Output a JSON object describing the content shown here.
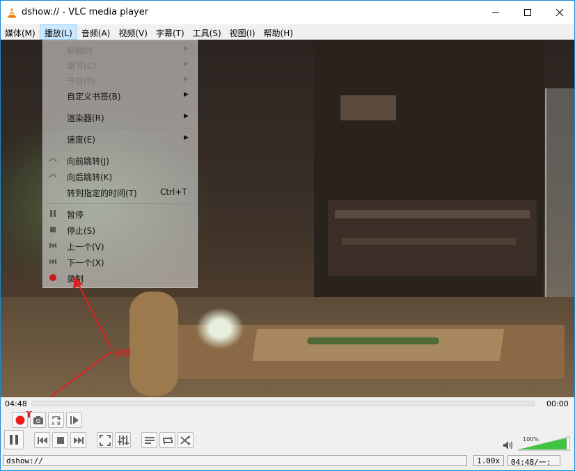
{
  "window": {
    "title": "dshow:// - VLC media player"
  },
  "menubar": [
    {
      "label": "媒体(M)"
    },
    {
      "label": "播放(L)"
    },
    {
      "label": "音频(A)"
    },
    {
      "label": "视频(V)"
    },
    {
      "label": "字幕(T)"
    },
    {
      "label": "工具(S)"
    },
    {
      "label": "视图(I)"
    },
    {
      "label": "帮助(H)"
    }
  ],
  "playback_menu": {
    "items": [
      {
        "label": "标题(I)",
        "disabled": true,
        "submenu": true
      },
      {
        "label": "章节(C)",
        "disabled": true,
        "submenu": true
      },
      {
        "label": "节目(P)",
        "disabled": true,
        "submenu": true
      },
      {
        "label": "自定义书签(B)",
        "submenu": true
      },
      {
        "label": "渲染器(R)",
        "submenu": true
      },
      {
        "label": "速度(E)",
        "submenu": true
      },
      {
        "label": "向前跳转(J)",
        "icon": "jump-forward-icon"
      },
      {
        "label": "向后跳转(K)",
        "icon": "jump-backward-icon"
      },
      {
        "label": "转到指定的时间(T)",
        "shortcut": "Ctrl+T"
      },
      {
        "label": "暂停",
        "icon": "pause-icon"
      },
      {
        "label": "停止(S)",
        "icon": "stop-icon"
      },
      {
        "label": "上一个(V)",
        "icon": "previous-icon"
      },
      {
        "label": "下一个(X)",
        "icon": "next-icon"
      },
      {
        "label": "录制",
        "icon": "record-icon"
      }
    ]
  },
  "annotation": {
    "text": "录制",
    "color": "#e02020"
  },
  "player": {
    "time_elapsed": "04:48",
    "time_remaining": "00:00",
    "volume_percent": "100%",
    "volume_level": 1.0
  },
  "status": {
    "media": "dshow://",
    "speed": "1.00x",
    "time": "04:48/一:一"
  },
  "colors": {
    "accent": "#1a8ad4",
    "record": "#e81c1c",
    "volume": "#3ec43e"
  }
}
